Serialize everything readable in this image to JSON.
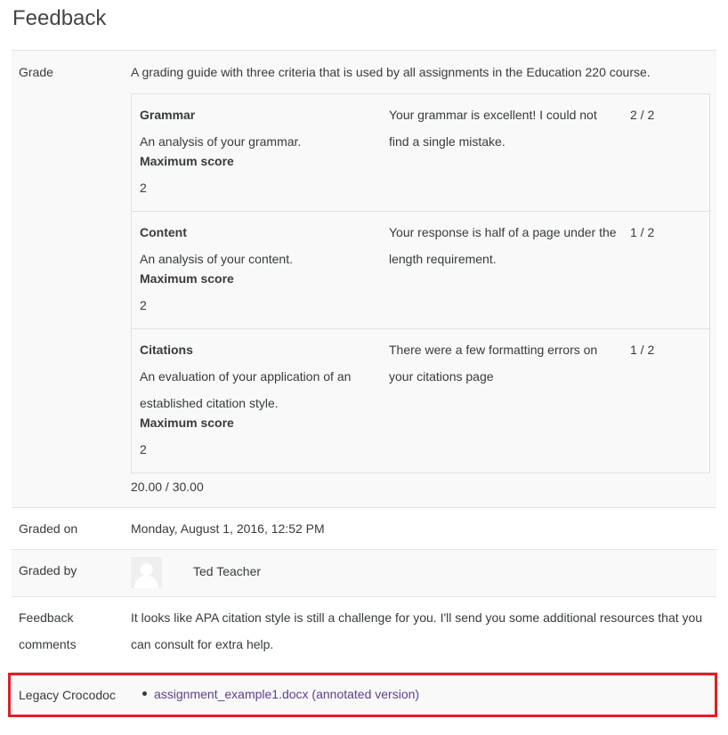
{
  "page": {
    "heading": "Feedback"
  },
  "grade": {
    "label": "Grade",
    "guide_description": "A grading guide with three criteria that is used by all assignments in the Education 220 course.",
    "criteria": [
      {
        "name": "Grammar",
        "description_lines": [
          "An analysis of your grammar."
        ],
        "max_label": "Maximum score",
        "max_value": "2",
        "remark_lines": [
          "Your grammar is excellent! I could not",
          "find a single mistake."
        ],
        "score": "2 / 2"
      },
      {
        "name": "Content",
        "description_lines": [
          "An analysis of your content."
        ],
        "max_label": "Maximum score",
        "max_value": "2",
        "remark_lines": [
          "Your response is half of a page under the",
          "length requirement."
        ],
        "score": "1 / 2"
      },
      {
        "name": "Citations",
        "description_lines": [
          "An evaluation of your application of an",
          "established citation style."
        ],
        "max_label": "Maximum score",
        "max_value": "2",
        "remark_lines": [
          "There were a few formatting errors on",
          "your citations page"
        ],
        "score": "1 / 2"
      }
    ],
    "total": "20.00 / 30.00"
  },
  "graded_on": {
    "label": "Graded on",
    "value": "Monday, August 1, 2016, 12:52 PM"
  },
  "graded_by": {
    "label": "Graded by",
    "name": "Ted Teacher"
  },
  "feedback_comments": {
    "label_lines": [
      "Feedback",
      "comments"
    ],
    "text_lines": [
      "It looks like APA citation style is still a challenge for you.  I'll send you some additional resources that you",
      "can consult for extra help."
    ]
  },
  "legacy_crocodoc": {
    "label": "Legacy Crocodoc",
    "link_text": "assignment_example1.docx (annotated version)"
  },
  "colors": {
    "highlight": "#e01e2b",
    "link": "#5b3f8c"
  }
}
